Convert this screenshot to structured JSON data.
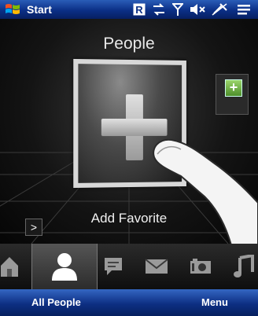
{
  "status_bar": {
    "start_label": "Start",
    "icons": [
      "windows-logo",
      "roaming-icon",
      "data-activity-icon",
      "signal-icon",
      "speaker-muted-icon",
      "no-signal-icon",
      "menu-lines-icon"
    ]
  },
  "main": {
    "title": "People",
    "favorite_card": {
      "caption": "Add Favorite",
      "icon": "plus-icon"
    },
    "next_arrow": ">"
  },
  "tabs": [
    {
      "name": "home",
      "icon": "house-icon",
      "active": false
    },
    {
      "name": "people",
      "icon": "person-icon",
      "active": true
    },
    {
      "name": "messages",
      "icon": "speech-bubble-icon",
      "active": false
    },
    {
      "name": "mail",
      "icon": "envelope-icon",
      "active": false
    },
    {
      "name": "photos",
      "icon": "camera-icon",
      "active": false
    },
    {
      "name": "music",
      "icon": "music-note-icon",
      "active": false
    }
  ],
  "softkeys": {
    "left": "All People",
    "right": "Menu"
  },
  "colors": {
    "bar_blue": "#0b2f86",
    "plus_green": "#6aab3a"
  }
}
